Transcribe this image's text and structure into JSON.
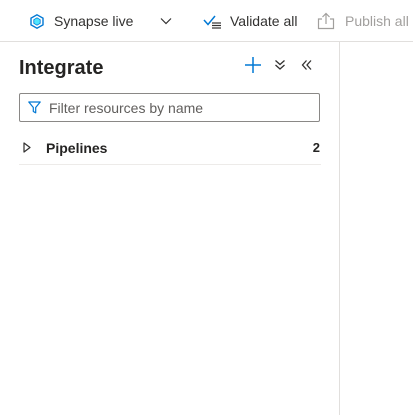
{
  "toolbar": {
    "mode_label": "Synapse live",
    "validate_label": "Validate all",
    "publish_label": "Publish all",
    "icons": {
      "mode": "synapse-workspace-icon",
      "mode_dropdown": "chevron-down-icon",
      "validate": "validate-checklist-icon",
      "publish": "publish-upload-icon"
    }
  },
  "panel": {
    "title": "Integrate",
    "icons": {
      "add": "plus-icon",
      "expand": "expand-all-icon",
      "collapse": "collapse-panel-icon"
    },
    "filter": {
      "placeholder": "Filter resources by name",
      "value": ""
    },
    "tree": [
      {
        "label": "Pipelines",
        "count": "2",
        "expanded": false
      }
    ]
  },
  "colors": {
    "accent": "#0078d4",
    "text": "#323130",
    "disabled": "#a19f9d",
    "border": "#e1dfdd"
  }
}
